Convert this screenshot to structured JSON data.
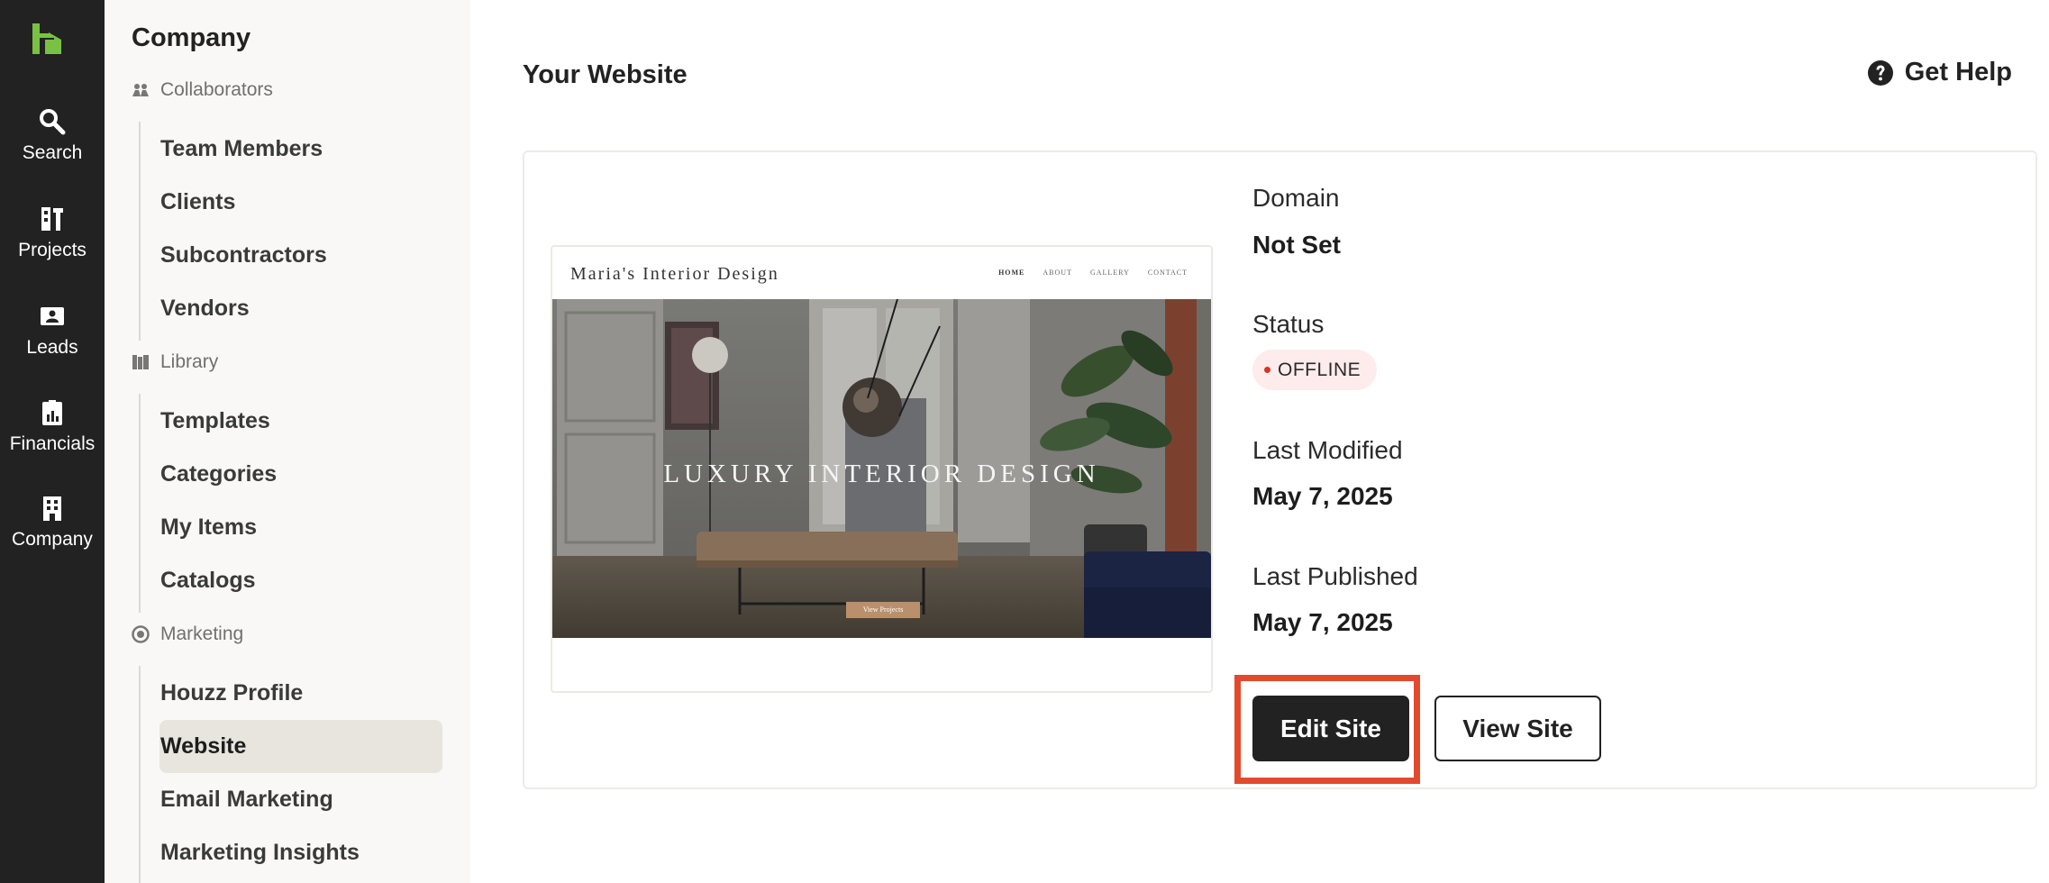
{
  "rail": {
    "logo_icon": "houzz-logo-icon",
    "items": [
      {
        "label": "Search",
        "icon": "search-icon"
      },
      {
        "label": "Projects",
        "icon": "projects-icon"
      },
      {
        "label": "Leads",
        "icon": "leads-icon"
      },
      {
        "label": "Financials",
        "icon": "financials-icon"
      },
      {
        "label": "Company",
        "icon": "company-icon"
      }
    ]
  },
  "subnav": {
    "title": "Company",
    "sections": [
      {
        "label": "Collaborators",
        "icon": "collaborators-icon",
        "items": [
          "Team Members",
          "Clients",
          "Subcontractors",
          "Vendors"
        ]
      },
      {
        "label": "Library",
        "icon": "library-icon",
        "items": [
          "Templates",
          "Categories",
          "My Items",
          "Catalogs"
        ]
      },
      {
        "label": "Marketing",
        "icon": "marketing-icon",
        "items": [
          "Houzz Profile",
          "Website",
          "Email Marketing",
          "Marketing Insights"
        ]
      }
    ],
    "active_item": "Website"
  },
  "main": {
    "title": "Your Website",
    "help_label": "Get Help",
    "preview": {
      "brand": "Maria's Interior Design",
      "nav": [
        "HOME",
        "ABOUT",
        "GALLERY",
        "CONTACT"
      ],
      "hero_title": "LUXURY INTERIOR DESIGN",
      "cta": "View Projects"
    },
    "domain": {
      "label": "Domain",
      "value": "Not Set"
    },
    "status": {
      "label": "Status",
      "value": "OFFLINE"
    },
    "last_modified": {
      "label": "Last Modified",
      "value": "May 7, 2025"
    },
    "last_published": {
      "label": "Last Published",
      "value": "May 7, 2025"
    },
    "edit_button": "Edit Site",
    "view_button": "View Site"
  },
  "colors": {
    "rail_bg": "#222222",
    "brand_green": "#7ac143",
    "subnav_bg": "#f9f8f6",
    "status_dot": "#d6332a",
    "highlight": "#e24a2b"
  }
}
